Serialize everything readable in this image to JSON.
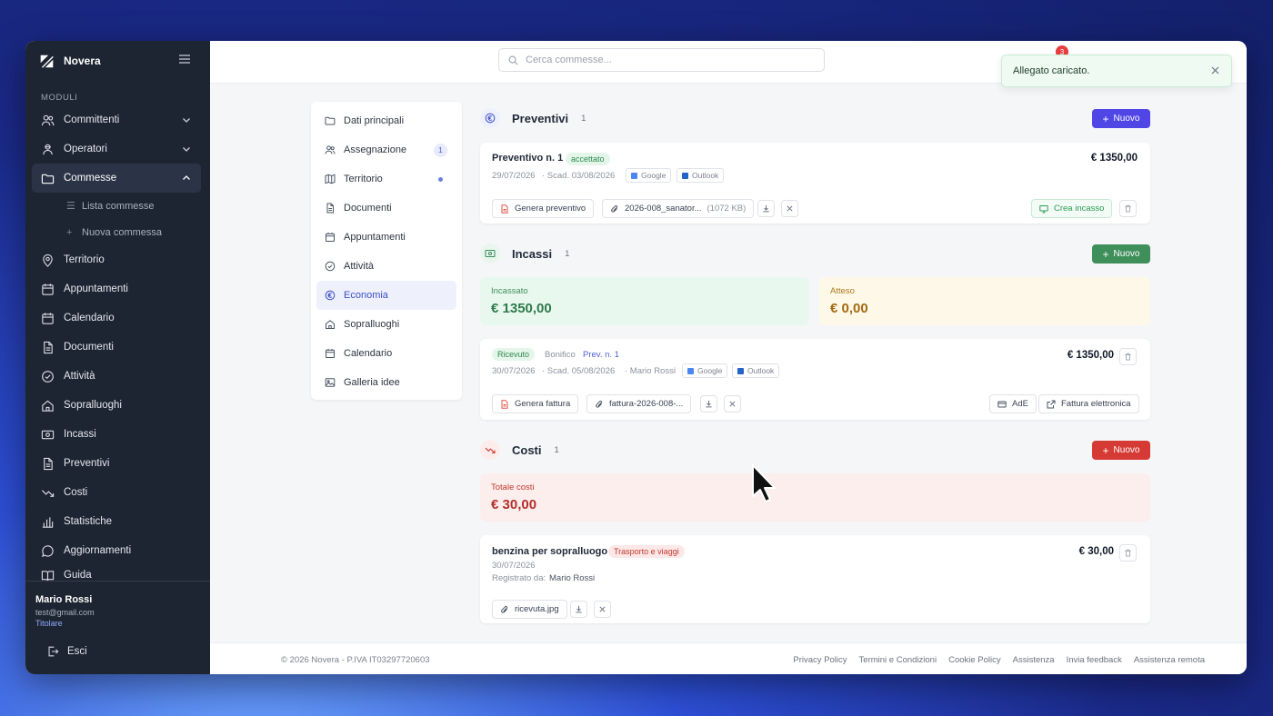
{
  "app": {
    "name": "Novera"
  },
  "sidebar": {
    "section_label": "MODULI",
    "items": [
      {
        "label": "Committenti"
      },
      {
        "label": "Operatori"
      },
      {
        "label": "Commesse"
      },
      {
        "label": "Territorio"
      },
      {
        "label": "Appuntamenti"
      },
      {
        "label": "Calendario"
      },
      {
        "label": "Documenti"
      },
      {
        "label": "Attività"
      },
      {
        "label": "Sopralluoghi"
      },
      {
        "label": "Incassi"
      },
      {
        "label": "Preventivi"
      },
      {
        "label": "Costi"
      },
      {
        "label": "Statistiche"
      },
      {
        "label": "Aggiornamenti"
      },
      {
        "label": "Guida"
      }
    ],
    "sub_items": [
      {
        "label": "Lista commesse"
      },
      {
        "label": "Nuova commessa"
      }
    ],
    "user": {
      "name": "Mario Rossi",
      "email": "test@gmail.com",
      "role": "Titolare"
    },
    "logout_label": "Esci"
  },
  "topbar": {
    "search_placeholder": "Cerca commesse...",
    "notification_count": "3",
    "toast": "Allegato caricato."
  },
  "subnav": {
    "items": [
      {
        "label": "Dati principali"
      },
      {
        "label": "Assegnazione",
        "badge": "1"
      },
      {
        "label": "Territorio"
      },
      {
        "label": "Documenti"
      },
      {
        "label": "Appuntamenti"
      },
      {
        "label": "Attività"
      },
      {
        "label": "Economia"
      },
      {
        "label": "Sopralluoghi"
      },
      {
        "label": "Calendario"
      },
      {
        "label": "Galleria idee"
      }
    ]
  },
  "preventivi": {
    "title": "Preventivi",
    "count": "1",
    "new_label": "Nuovo",
    "item": {
      "title": "Preventivo n. 1",
      "status": "accettato",
      "date": "29/07/2026",
      "due": "· Scad. 03/08/2026",
      "amount": "€ 1350,00",
      "google": "Google",
      "outlook": "Outlook",
      "generate_label": "Genera preventivo",
      "attachment_name": "2026-008_sanator...",
      "attachment_size": "(1072 KB)",
      "create_income_label": "Crea incasso"
    }
  },
  "incassi": {
    "title": "Incassi",
    "count": "1",
    "new_label": "Nuovo",
    "collected_label": "Incassato",
    "collected_value": "€ 1350,00",
    "expected_label": "Atteso",
    "expected_value": "€ 0,00",
    "item": {
      "status": "Ricevuto",
      "method": "Bonifico",
      "ref": "Prev. n. 1",
      "date": "30/07/2026",
      "due": "· Scad. 05/08/2026",
      "operator": "· Mario Rossi",
      "google": "Google",
      "outlook": "Outlook",
      "amount": "€ 1350,00",
      "generate_label": "Genera fattura",
      "attachment_name": "fattura-2026-008-...",
      "ade_label": "AdE",
      "einvoice_label": "Fattura elettronica"
    }
  },
  "costi": {
    "title": "Costi",
    "count": "1",
    "new_label": "Nuovo",
    "total_label": "Totale costi",
    "total_value": "€ 30,00",
    "item": {
      "title": "benzina per sopralluogo",
      "category": "Trasporto e viaggi",
      "date": "30/07/2026",
      "registered_label": "Registrato da:",
      "registered_by": "Mario Rossi",
      "amount": "€ 30,00",
      "attachment_name": "ricevuta.jpg"
    }
  },
  "footer": {
    "copyright": "© 2026 Novera - P.IVA IT03297720603",
    "links": [
      "Privacy Policy",
      "Termini e Condizioni",
      "Cookie Policy",
      "Assistenza",
      "Invia feedback",
      "Assistenza remota"
    ]
  },
  "colors": {
    "sidebar_bg": "#1e2532",
    "accent_indigo": "#4f46e5",
    "accent_green": "#3f8f5b",
    "accent_red": "#d63a34"
  }
}
